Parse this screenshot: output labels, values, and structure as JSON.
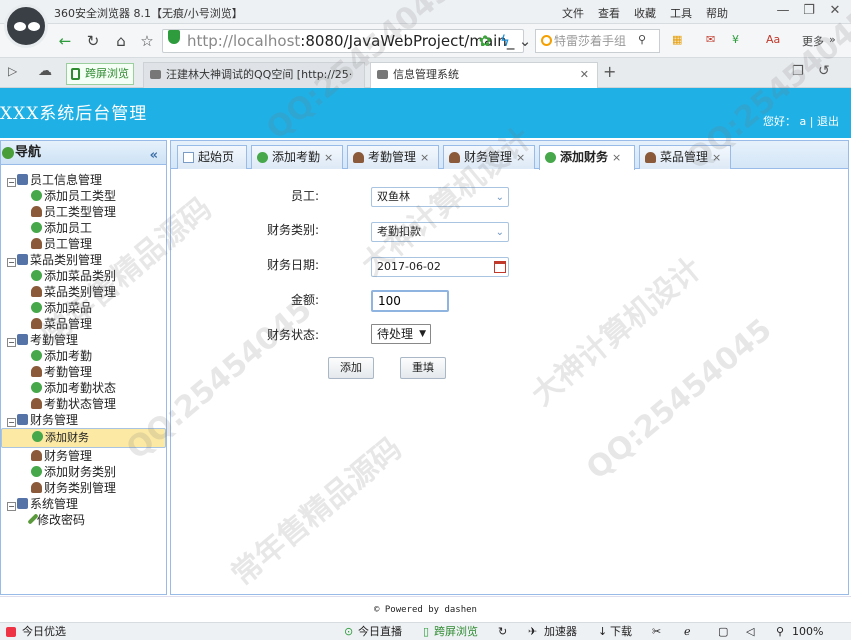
{
  "browser": {
    "title": "360安全浏览器 8.1【无痕/小号浏览】",
    "menu": [
      "文件",
      "查看",
      "收藏",
      "工具",
      "帮助"
    ],
    "window_buttons": [
      "—",
      "❐",
      "✕"
    ],
    "url_host": "http://localhost",
    "url_rest": ":8080/JavaWebProject/main_",
    "search_placeholder": "特雷莎着手组",
    "more_label": "更多",
    "tabs": [
      {
        "label": "汪建林大神调试的QQ空间 [http://25·"
      },
      {
        "label": "信息管理系统"
      }
    ],
    "split_label": "跨屏浏览"
  },
  "app": {
    "name": "XXX系统后台管理",
    "greeting": "您好：",
    "user": "a",
    "logout": "退出"
  },
  "sidebar": {
    "title": "导航",
    "collapse": "«",
    "groups": [
      {
        "label": "员工信息管理",
        "items": [
          "添加员工类型",
          "员工类型管理",
          "添加员工",
          "员工管理"
        ]
      },
      {
        "label": "菜品类别管理",
        "items": [
          "添加菜品类别",
          "菜品类别管理",
          "添加菜品",
          "菜品管理"
        ]
      },
      {
        "label": "考勤管理",
        "items": [
          "添加考勤",
          "考勤管理",
          "添加考勤状态",
          "考勤状态管理"
        ]
      },
      {
        "label": "财务管理",
        "items": [
          "添加财务",
          "财务管理",
          "添加财务类别",
          "财务类别管理"
        ]
      },
      {
        "label": "系统管理",
        "items": [
          "修改密码"
        ]
      }
    ],
    "selected": "添加财务"
  },
  "content_tabs": [
    {
      "label": "起始页"
    },
    {
      "label": "添加考勤",
      "x": "×"
    },
    {
      "label": "考勤管理",
      "x": "×"
    },
    {
      "label": "财务管理",
      "x": "×"
    },
    {
      "label": "添加财务",
      "x": "×"
    },
    {
      "label": "菜品管理",
      "x": "×"
    }
  ],
  "form": {
    "employee_label": "员工:",
    "employee_value": "双鱼林",
    "category_label": "财务类别:",
    "category_value": "考勤扣款",
    "date_label": "财务日期:",
    "date_value": "2017-06-02",
    "amount_label": "金额:",
    "amount_value": "100",
    "status_label": "财务状态:",
    "status_value": "待处理",
    "add_button": "添加",
    "reset_button": "重填"
  },
  "footer": "© Powered by dashen",
  "statusbar": {
    "left": "今日优选",
    "items": [
      "今日直播",
      "跨屏浏览",
      "加速器",
      "下载"
    ],
    "zoom": "100%"
  },
  "watermarks": [
    "QQ:25454045",
    "大神计算机设计",
    "常年售精品源码",
    "QQ:25454045",
    "大神计算机设计",
    "QQ:25454045",
    "常年售精品源码",
    "QQ:25454045"
  ]
}
